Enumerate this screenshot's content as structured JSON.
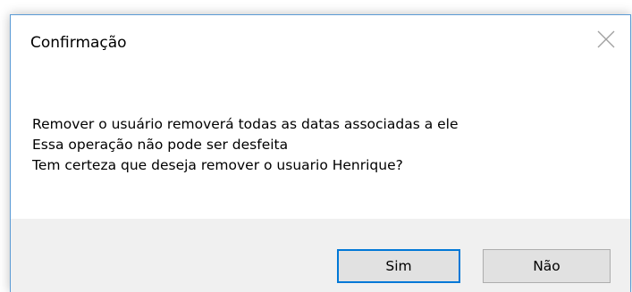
{
  "dialog": {
    "title": "Confirmação",
    "close_icon": "close-icon",
    "message": {
      "line1": "Remover o usuário removerá todas as datas associadas a ele",
      "line2": "Essa operação não pode ser desfeita",
      "line3": "Tem certeza que deseja remover o usuario Henrique?"
    },
    "buttons": {
      "yes_label": "Sim",
      "no_label": "Não"
    }
  },
  "colors": {
    "accent": "#0078d7",
    "border": "#5b9bd5",
    "footer_bg": "#f0f0f0",
    "button_bg": "#e1e1e1"
  }
}
